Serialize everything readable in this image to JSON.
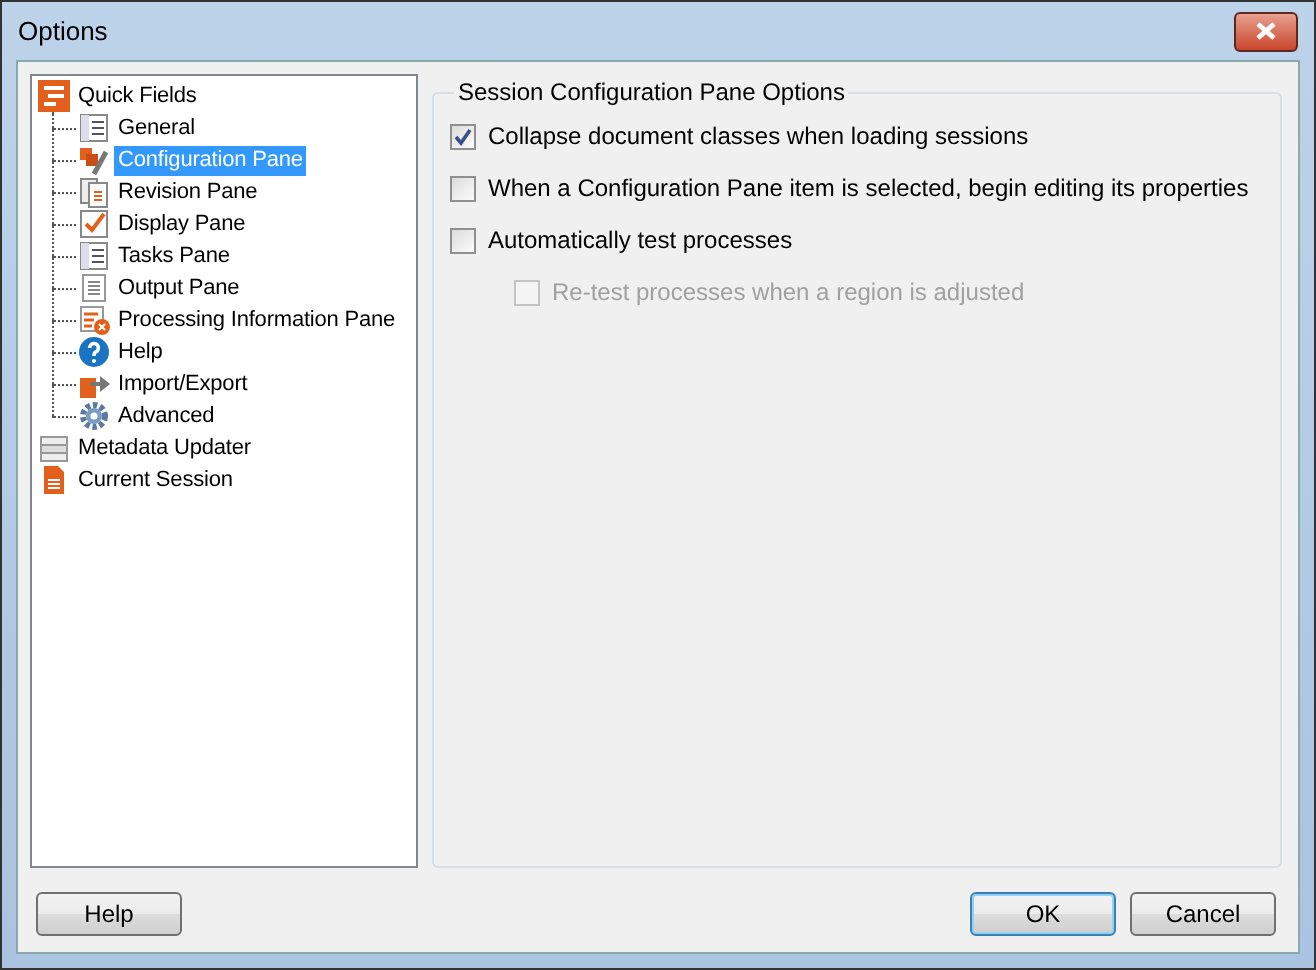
{
  "window": {
    "title": "Options"
  },
  "tree": [
    {
      "label": "Quick Fields",
      "kind": "quickfields",
      "selected": false,
      "children": [
        {
          "label": "General",
          "kind": "list",
          "selected": false
        },
        {
          "label": "Configuration Pane",
          "kind": "tools",
          "selected": true
        },
        {
          "label": "Revision Pane",
          "kind": "doc",
          "selected": false
        },
        {
          "label": "Display Pane",
          "kind": "check",
          "selected": false
        },
        {
          "label": "Tasks Pane",
          "kind": "list",
          "selected": false
        },
        {
          "label": "Output Pane",
          "kind": "lines",
          "selected": false
        },
        {
          "label": "Processing Information Pane",
          "kind": "error",
          "selected": false
        },
        {
          "label": "Help",
          "kind": "help",
          "selected": false
        },
        {
          "label": "Import/Export",
          "kind": "export",
          "selected": false
        },
        {
          "label": "Advanced",
          "kind": "gear",
          "selected": false
        }
      ]
    },
    {
      "label": "Metadata Updater",
      "kind": "stack",
      "selected": false
    },
    {
      "label": "Current Session",
      "kind": "page",
      "selected": false
    }
  ],
  "group": {
    "title": "Session Configuration Pane Options",
    "options": [
      {
        "label": "Collapse document classes when loading sessions",
        "checked": true,
        "disabled": false
      },
      {
        "label": "When a Configuration Pane item is selected, begin editing its properties",
        "checked": false,
        "disabled": false
      },
      {
        "label": "Automatically test processes",
        "checked": false,
        "disabled": false,
        "children": [
          {
            "label": "Re-test processes when a region is adjusted",
            "checked": false,
            "disabled": true
          }
        ]
      }
    ]
  },
  "buttons": [
    {
      "label": "Help",
      "default": false
    },
    {
      "label": "OK",
      "default": true
    },
    {
      "label": "Cancel",
      "default": false
    }
  ]
}
